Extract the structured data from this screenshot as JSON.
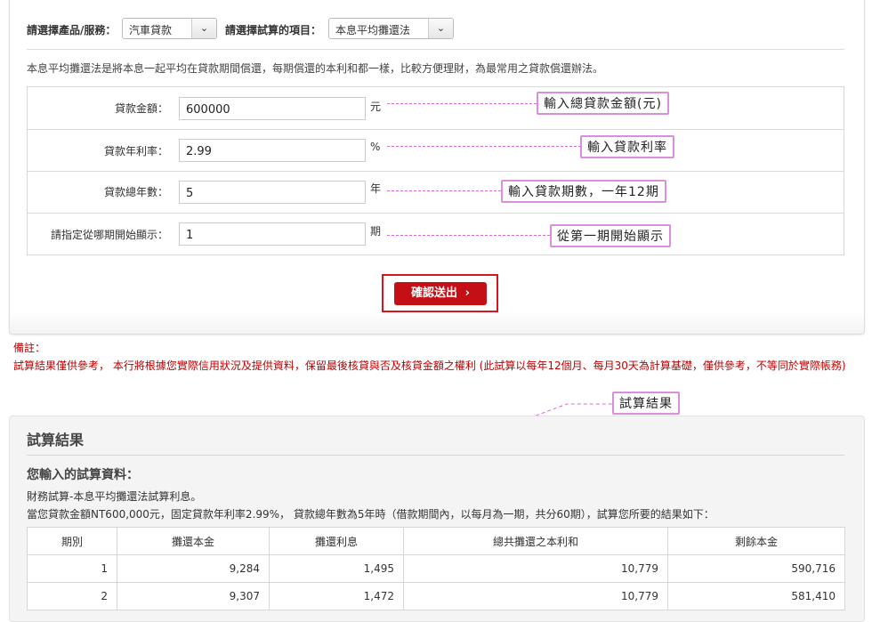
{
  "selectors": {
    "product_label": "請選擇產品/服務：",
    "product_value": "汽車貸款",
    "item_label": "請選擇試算的項目：",
    "item_value": "本息平均攤還法"
  },
  "description": "本息平均攤還法是將本息一起平均在貸款期間償還，每期償還的本利和都一樣，比較方便理財，為最常用之貸款償還辦法。",
  "form": {
    "rows": [
      {
        "label": "貸款金額：",
        "value": "600000",
        "unit": "元",
        "callout": "輸入總貸款金額(元)"
      },
      {
        "label": "貸款年利率：",
        "value": "2.99",
        "unit": "%",
        "callout": "輸入貸款利率"
      },
      {
        "label": "貸款總年數：",
        "value": "5",
        "unit": "年",
        "callout": "輸入貸款期數，一年12期"
      },
      {
        "label": "請指定從哪期開始顯示：",
        "value": "1",
        "unit": "期",
        "callout": "從第一期開始顯示"
      }
    ],
    "submit_label": "確認送出",
    "submit_icon": "chevron-right-icon"
  },
  "notes": {
    "heading": "備註：",
    "body": "試算結果僅供參考， 本行將根據您實際信用狀況及提供資料，保留最後核貸與否及核貸金額之權利 (此試算以每年12個月、每月30天為計算基礎，僅供參考，不等同於實際帳務)"
  },
  "result_callout": "試算結果",
  "result": {
    "title": "試算結果",
    "subtitle": "您輸入的試算資料：",
    "line1": "財務試算-本息平均攤還法試算利息。",
    "line2": "當您貸款金額NT600,000元，固定貸款年利率2.99%， 貸款總年數為5年時（借款期間內，以每月為一期，共分60期），試算您所要的結果如下：",
    "columns": [
      "期別",
      "攤還本金",
      "攤還利息",
      "總共攤還之本利和",
      "剩餘本金"
    ],
    "rows": [
      [
        "1",
        "9,284",
        "1,495",
        "10,779",
        "590,716"
      ],
      [
        "2",
        "9,307",
        "1,472",
        "10,779",
        "581,410"
      ]
    ]
  },
  "colors": {
    "accent": "#c40f16",
    "callout_border": "#d98fd9",
    "note_text": "#c00000"
  }
}
